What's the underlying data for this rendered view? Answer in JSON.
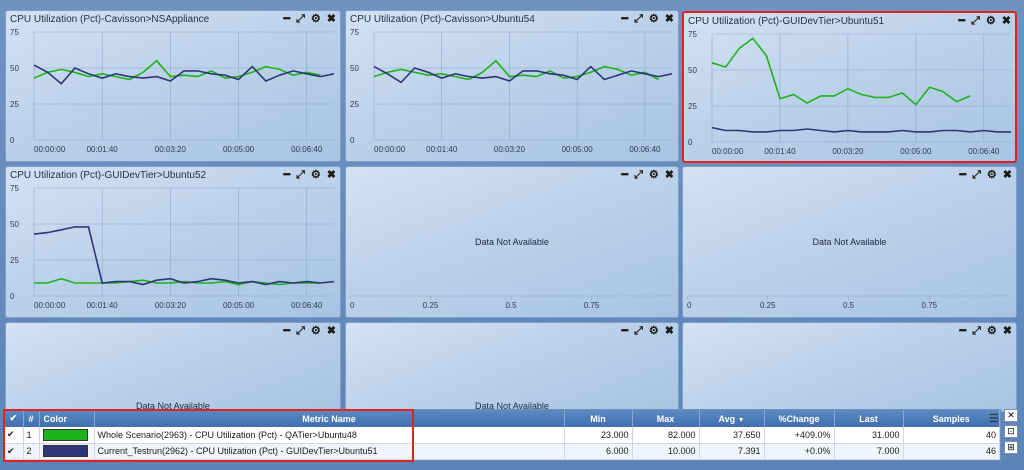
{
  "colors": {
    "green": "#1db31d",
    "navy": "#2e3578",
    "selected_border": "#e0231b"
  },
  "panels": [
    {
      "title": "CPU Utilization (Pct)-Cavisson>NSAppliance",
      "state": "chart",
      "chart_data": {
        "type": "line",
        "ylim": [
          0,
          75
        ],
        "yticks": [
          "0",
          "25",
          "50",
          "75"
        ],
        "xticks": [
          "00:00:00",
          "00:01:40",
          "00:03:20",
          "00:05:00",
          "00:06:40"
        ],
        "x": [
          0,
          20,
          40,
          60,
          80,
          100,
          120,
          140,
          160,
          180,
          200,
          220,
          240,
          260,
          280,
          300,
          320,
          340,
          360,
          380,
          400,
          420,
          440
        ],
        "series": [
          {
            "color": "green",
            "values": [
              43,
              47,
              49,
              47,
              44,
              46,
              44,
              42,
              47,
              55,
              44,
              45,
              44,
              48,
              43,
              44,
              47,
              51,
              49,
              45,
              47,
              45,
              null
            ]
          },
          {
            "color": "navy",
            "values": [
              52,
              47,
              39,
              50,
              46,
              43,
              46,
              44,
              43,
              44,
              41,
              48,
              48,
              46,
              45,
              42,
              51,
              41,
              45,
              48,
              46,
              44,
              46
            ]
          }
        ]
      }
    },
    {
      "title": "CPU Utilization (Pct)-Cavisson>Ubuntu54",
      "state": "chart",
      "chart_data": {
        "type": "line",
        "ylim": [
          0,
          75
        ],
        "yticks": [
          "0",
          "25",
          "50",
          "75"
        ],
        "xticks": [
          "00:00:00",
          "00:01:40",
          "00:03:20",
          "00:05:00",
          "00:06:40"
        ],
        "x": [
          0,
          20,
          40,
          60,
          80,
          100,
          120,
          140,
          160,
          180,
          200,
          220,
          240,
          260,
          280,
          300,
          320,
          340,
          360,
          380,
          400,
          420,
          440
        ],
        "series": [
          {
            "color": "green",
            "values": [
              44,
              47,
              49,
              47,
              45,
              46,
              44,
              42,
              47,
              55,
              44,
              45,
              44,
              48,
              43,
              44,
              47,
              51,
              49,
              45,
              47,
              42,
              null
            ]
          },
          {
            "color": "navy",
            "values": [
              51,
              46,
              40,
              50,
              47,
              43,
              46,
              44,
              43,
              44,
              41,
              48,
              48,
              46,
              45,
              42,
              51,
              42,
              45,
              48,
              46,
              44,
              46
            ]
          }
        ]
      }
    },
    {
      "title": "CPU Utilization (Pct)-GUIDevTier>Ubuntu51",
      "state": "chart",
      "selected": true,
      "chart_data": {
        "type": "line",
        "ylim": [
          0,
          75
        ],
        "yticks": [
          "0",
          "25",
          "50",
          "75"
        ],
        "xticks": [
          "00:00:00",
          "00:01:40",
          "00:03:20",
          "00:05:00",
          "00:06:40"
        ],
        "x": [
          0,
          20,
          40,
          60,
          80,
          100,
          120,
          140,
          160,
          180,
          200,
          220,
          240,
          260,
          280,
          300,
          320,
          340,
          360,
          380,
          400,
          420,
          440
        ],
        "series": [
          {
            "color": "green",
            "values": [
              55,
              52,
              65,
              72,
              60,
              30,
              33,
              27,
              32,
              32,
              37,
              33,
              31,
              31,
              34,
              26,
              38,
              35,
              28,
              32,
              null,
              null,
              null
            ]
          },
          {
            "color": "navy",
            "values": [
              10,
              8,
              8,
              7,
              7,
              8,
              8,
              9,
              8,
              7,
              8,
              7,
              7,
              7,
              8,
              7,
              7,
              8,
              8,
              7,
              8,
              7,
              7
            ]
          }
        ]
      }
    },
    {
      "title": "CPU Utilization (Pct)-GUIDevTier>Ubuntu52",
      "state": "chart",
      "chart_data": {
        "type": "line",
        "ylim": [
          0,
          75
        ],
        "yticks": [
          "0",
          "25",
          "50",
          "75"
        ],
        "xticks": [
          "00:00:00",
          "00:01:40",
          "00:03:20",
          "00:05:00",
          "00:06:40"
        ],
        "x": [
          0,
          20,
          40,
          60,
          80,
          100,
          120,
          140,
          160,
          180,
          200,
          220,
          240,
          260,
          280,
          300,
          320,
          340,
          360,
          380,
          400,
          420,
          440
        ],
        "series": [
          {
            "color": "green",
            "values": [
              9,
              9,
              12,
              9,
              9,
              9,
              9,
              10,
              11,
              9,
              9,
              10,
              9,
              9,
              10,
              8,
              10,
              9,
              8,
              9,
              9,
              9,
              null
            ]
          },
          {
            "color": "navy",
            "values": [
              43,
              44,
              46,
              48,
              48,
              9,
              10,
              10,
              8,
              11,
              12,
              9,
              10,
              12,
              11,
              9,
              10,
              8,
              10,
              9,
              10,
              9,
              10
            ]
          }
        ]
      }
    },
    {
      "title": "",
      "state": "empty",
      "message": "Data Not Available",
      "xticks": [
        "0",
        "0.25",
        "0.5",
        "0.75"
      ]
    },
    {
      "title": "",
      "state": "empty",
      "message": "Data Not Available",
      "xticks": [
        "0",
        "0.25",
        "0.5",
        "0.75"
      ]
    },
    {
      "title": "",
      "state": "empty-partial",
      "message": "Data Not Available"
    },
    {
      "title": "",
      "state": "empty-partial",
      "message": "Data Not Available"
    },
    {
      "title": "",
      "state": "empty-partial",
      "message": ""
    }
  ],
  "legend": {
    "headers": {
      "check": "✔",
      "num": "#",
      "color": "Color",
      "metric": "Metric Name",
      "min": "Min",
      "max": "Max",
      "avg": "Avg",
      "change": "%Change",
      "last": "Last",
      "samples": "Samples"
    },
    "rows": [
      {
        "check": "✔",
        "num": "1",
        "color": "#1db31d",
        "metric": "Whole Scenario(2963) - CPU Utilization (Pct) - QATier>Ubuntu48",
        "min": "23.000",
        "max": "82.000",
        "avg": "37.650",
        "change": "+409.0%",
        "last": "31.000",
        "samples": "40"
      },
      {
        "check": "✔",
        "num": "2",
        "color": "#2e3578",
        "metric": "Current_Testrun(2962) - CPU Utilization (Pct) - GUIDevTier>Ubuntu51",
        "min": "6.000",
        "max": "10.000",
        "avg": "7.391",
        "change": "+0.0%",
        "last": "7.000",
        "samples": "46"
      }
    ]
  }
}
